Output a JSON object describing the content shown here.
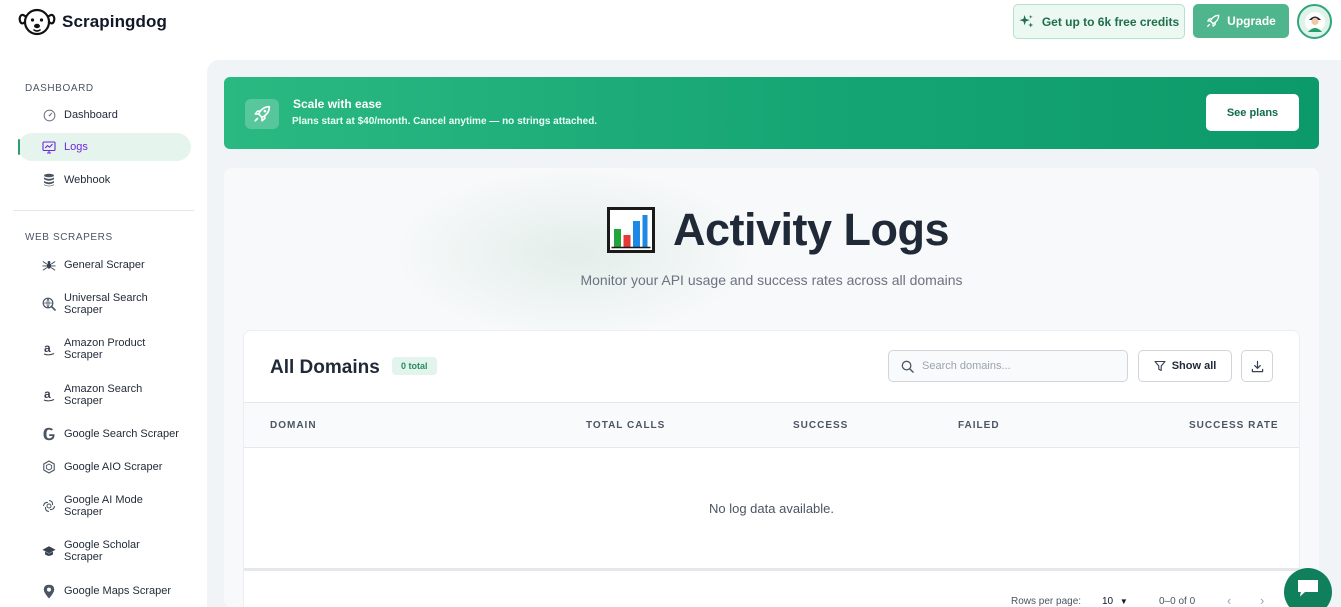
{
  "header": {
    "brand_name": "Scrapingdog",
    "credits_label": "Get up to 6k free credits",
    "upgrade_label": "Upgrade"
  },
  "sidebar": {
    "sections": [
      {
        "title": "DASHBOARD",
        "items": [
          {
            "label": "Dashboard",
            "icon": "gauge-icon"
          },
          {
            "label": "Logs",
            "icon": "monitor-chart-icon",
            "active": true
          },
          {
            "label": "Webhook",
            "icon": "database-icon"
          }
        ]
      },
      {
        "title": "WEB SCRAPERS",
        "items": [
          {
            "label": "General Scraper",
            "icon": "spider-icon"
          },
          {
            "label": "Universal Search Scraper",
            "icon": "search-globe-icon"
          },
          {
            "label": "Amazon Product Scraper",
            "icon": "amazon-icon"
          },
          {
            "label": "Amazon Search Scraper",
            "icon": "amazon-icon"
          },
          {
            "label": "Google Search Scraper",
            "icon": "google-icon"
          },
          {
            "label": "Google AIO Scraper",
            "icon": "hexagon-icon"
          },
          {
            "label": "Google AI Mode Scraper",
            "icon": "ai-swirl-icon"
          },
          {
            "label": "Google Scholar Scraper",
            "icon": "graduation-cap-icon"
          },
          {
            "label": "Google Maps Scraper",
            "icon": "map-pin-icon"
          }
        ]
      }
    ]
  },
  "banner": {
    "title": "Scale with ease",
    "subtitle": "Plans start at $40/month. Cancel anytime — no strings attached.",
    "button_label": "See plans"
  },
  "page": {
    "title": "Activity Logs",
    "subtitle": "Monitor your API usage and success rates across all domains"
  },
  "card": {
    "title": "All Domains",
    "badge": "0 total",
    "search_placeholder": "Search domains...",
    "filter_label": "Show all",
    "columns": [
      "DOMAIN",
      "TOTAL CALLS",
      "SUCCESS",
      "FAILED",
      "SUCCESS RATE"
    ],
    "empty_message": "No log data available.",
    "rows_per_page_label": "Rows per page:",
    "rows_per_page_value": "10",
    "range_label": "0–0 of 0"
  },
  "colors": {
    "accent": "#15a574",
    "accent_dark": "#0f7f5c",
    "active_text": "#6d28d9"
  }
}
